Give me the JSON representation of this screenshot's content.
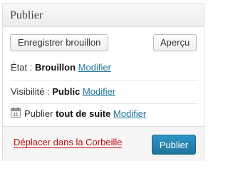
{
  "panel": {
    "title": "Publier"
  },
  "actions": {
    "save_draft_label": "Enregistrer brouillon",
    "preview_label": "Aperçu"
  },
  "status": {
    "label": "État :",
    "value": "Brouillon",
    "edit_label": "Modifier"
  },
  "visibility": {
    "label": "Visibilité :",
    "value": "Public",
    "edit_label": "Modifier"
  },
  "schedule": {
    "icon": "calendar-icon",
    "label": "Publier",
    "value": "tout de suite",
    "edit_label": "Modifier"
  },
  "footer": {
    "trash_label": "Déplacer dans la Corbeille",
    "publish_label": "Publier"
  },
  "colors": {
    "link": "#21759b",
    "trash": "#bc0b0b",
    "primary": "#21759b"
  }
}
